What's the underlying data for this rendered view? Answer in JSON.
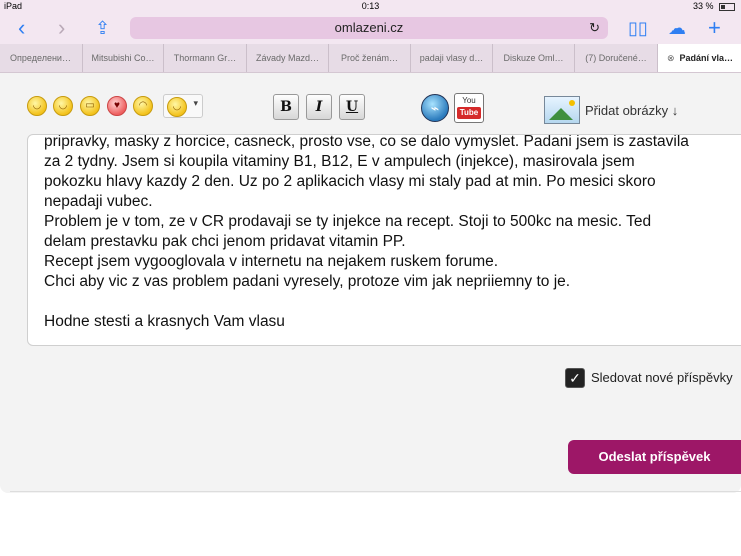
{
  "status_bar": {
    "device": "iPad",
    "time": "0:13",
    "battery": "33 %"
  },
  "browser": {
    "url": "omlazeni.cz",
    "icons": [
      "back-icon",
      "forward-icon",
      "share-icon",
      "reload-icon",
      "bookmarks-icon",
      "cloud-tabs-icon",
      "new-tab-icon"
    ]
  },
  "tabs": [
    "Определени…",
    "Mitsubishi Co…",
    "Thormann Gr…",
    "Závady Mazd…",
    "Proč ženám…",
    "padaji vlasy d…",
    "Diskuze Oml…",
    "(7) Doručené…",
    "Padání vla…"
  ],
  "toolbar": {
    "bold": "B",
    "italic": "I",
    "underline": "U",
    "youtube_top": "You",
    "youtube_bottom": "Tube",
    "add_images": "Přidat obrázky ↓"
  },
  "message_lines": [
    "pripravky, masky z horcice, casneck, prosto vse, co se dalo vymyslet. Padani jsem is zastavila",
    "za 2 tydny. Jsem si koupila vitaminy B1, B12, E v ampulech (injekce), masirovala jsem",
    "pokozku hlavy kazdy 2 den. Uz po 2 aplikacich vlasy mi staly pad at min. Po mesici skoro",
    "nepadaji vubec.",
    "Problem je v tom, ze v CR prodavaji se ty injekce na recept. Stoji to 500kc na mesic. Ted",
    "delam prestavku pak chci jenom pridavat vitamin PP.",
    "Recept jsem vygooglovala v internetu na nejakem ruskem forume.",
    "Chci aby vic z vas problem padani vyresely, protoze vim jak nepriiemny to je.",
    "",
    "Hodne stesti a krasnych Vam vlasu"
  ],
  "follow_label": "Sledovat nové příspěvky",
  "follow_checked": true,
  "submit_label": "Odeslat příspěvek",
  "colors": {
    "accent": "#9d1767",
    "browser_chrome": "#f3e7f1",
    "link": "#2f7ff2"
  }
}
